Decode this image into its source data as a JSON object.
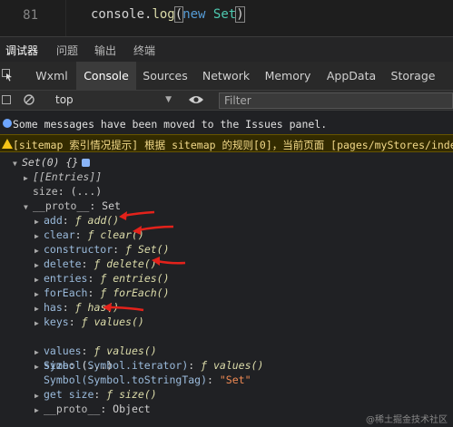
{
  "editor": {
    "line_number": "81",
    "code": {
      "obj": "console",
      "dot": ".",
      "method": "log",
      "open": "(",
      "kw": "new",
      "space": " ",
      "cls": "Set",
      "close": ")"
    }
  },
  "panel_tabs": [
    "调试器",
    "问题",
    "输出",
    "终端"
  ],
  "devtools_tabs": [
    "Wxml",
    "Console",
    "Sources",
    "Network",
    "Memory",
    "AppData",
    "Storage"
  ],
  "toolbar": {
    "context": "top",
    "filter_placeholder": "Filter"
  },
  "messages": {
    "info": "Some messages have been moved to the Issues panel.",
    "warning": "[sitemap 索引情况提示] 根据 sitemap 的规则[0]，当前页面 [pages/myStores/index"
  },
  "tree": {
    "root": "Set(0) {}",
    "entries": "[[Entries]]",
    "size_key": "size",
    "size_val": "(...)",
    "proto_key": "__proto__",
    "proto_val": "Set",
    "f": "ƒ",
    "items": [
      {
        "key": "add",
        "fn": "add()"
      },
      {
        "key": "clear",
        "fn": "clear()"
      },
      {
        "key": "constructor",
        "fn": "Set()"
      },
      {
        "key": "delete",
        "fn": "delete()"
      },
      {
        "key": "entries",
        "fn": "entries()"
      },
      {
        "key": "forEach",
        "fn": "forEach()"
      },
      {
        "key": "has",
        "fn": "has()"
      },
      {
        "key": "keys",
        "fn": "values()"
      },
      {
        "key": "values",
        "fn": "values()"
      },
      {
        "key": "Symbol(Symbol.iterator)",
        "fn": "values()"
      },
      {
        "key": "get size",
        "fn": "size()"
      }
    ],
    "proto_size_key": "size",
    "proto_size_val": "(...)",
    "to_string_tag_key": "Symbol(Symbol.toStringTag)",
    "to_string_tag_val": "\"Set\"",
    "inner_proto_key": "__proto__",
    "inner_proto_val": "Object"
  },
  "watermark": "@稀土掘金技术社区",
  "colors": {
    "annotation_arrow": "#e3221b",
    "active_tab": "#3b3b3b",
    "warning_bg": "#332b00"
  }
}
